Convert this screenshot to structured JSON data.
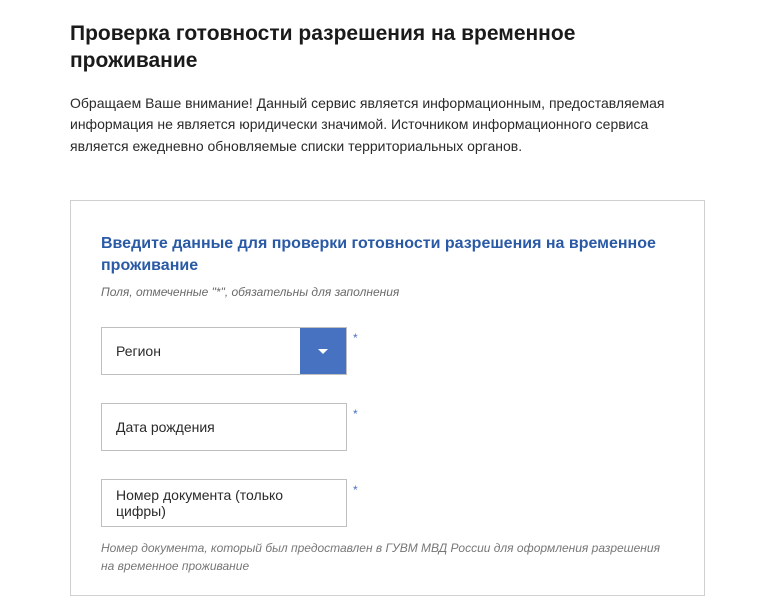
{
  "page_title": "Проверка готовности разрешения на временное проживание",
  "intro_text": "Обращаем Ваше внимание! Данный сервис является информационным, предоставляемая информация не является юридически значимой. Источником информационного сервиса является ежедневно обновляемые списки территориальных органов.",
  "form": {
    "heading": "Введите данные для проверки готовности разрешения на временное проживание",
    "required_note": "Поля, отмеченные \"*\", обязательны для заполнения",
    "region": {
      "placeholder": "Регион",
      "required_marker": "*"
    },
    "dob": {
      "placeholder": "Дата рождения",
      "required_marker": "*"
    },
    "doc_number": {
      "placeholder": "Номер документа (только цифры)",
      "required_marker": "*",
      "hint": "Номер документа, который был предоставлен в ГУВМ МВД России для оформления разрешения на временное проживание"
    }
  }
}
